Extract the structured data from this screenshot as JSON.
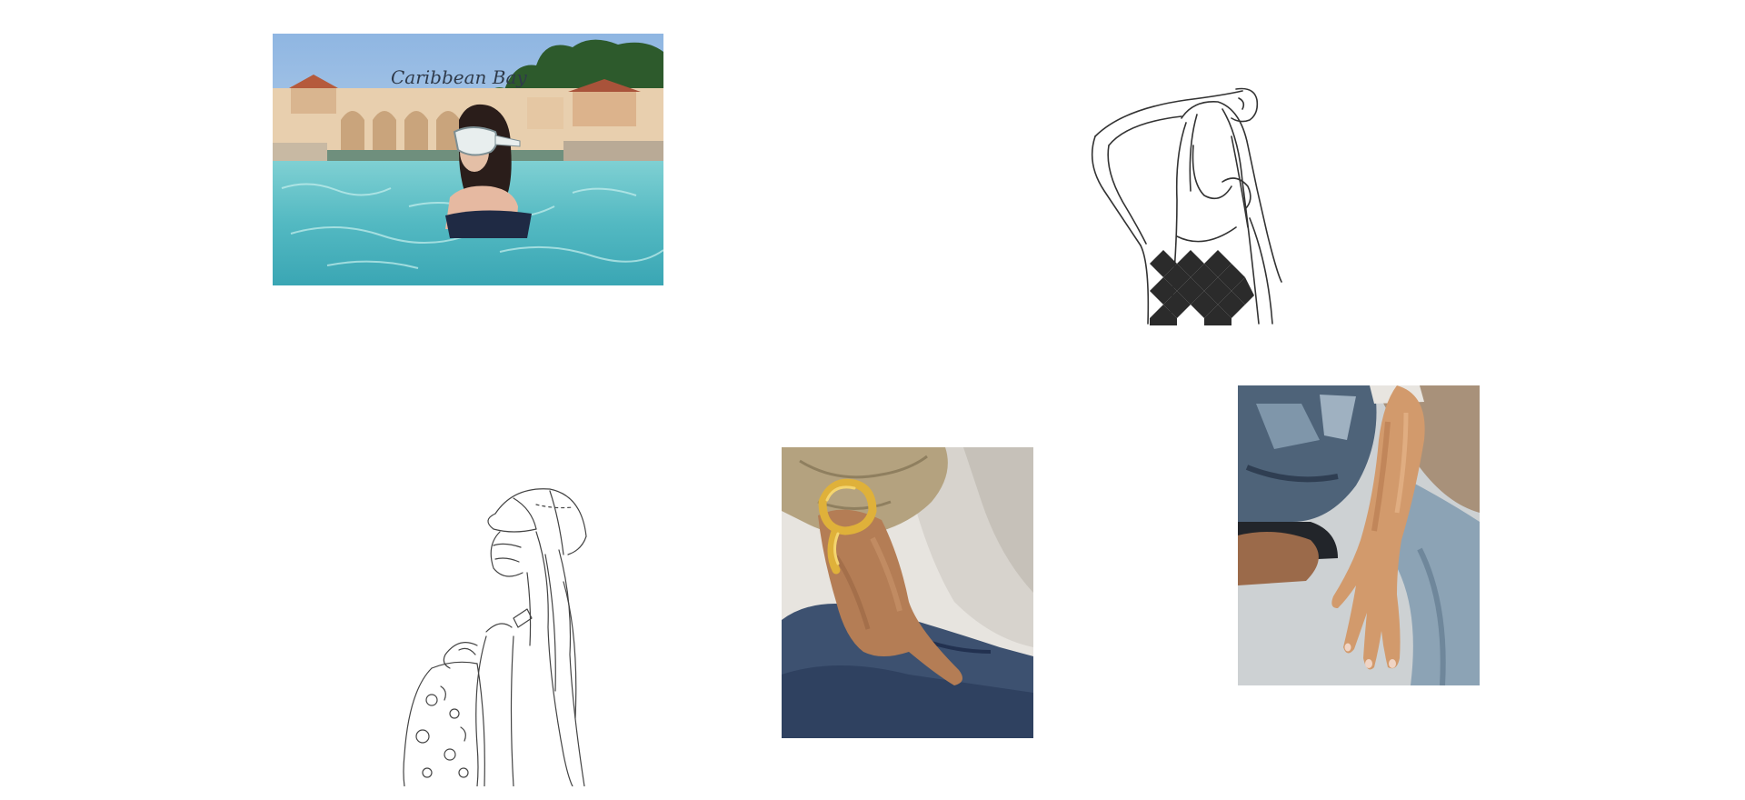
{
  "gallery": {
    "items": [
      {
        "name": "pool-photo",
        "kind": "photo",
        "sign_text": "Caribbean Bay",
        "colors": {
          "sky": "#9fc3e6",
          "water": "#5fc2c4",
          "building": "#e9cfae",
          "trees": "#2e5a2e"
        }
      },
      {
        "name": "lineart-raised-arm",
        "kind": "line-art",
        "colors": {
          "stroke": "#333333",
          "fill": "#2b2b2b"
        }
      },
      {
        "name": "lineart-cap-backpack",
        "kind": "line-art",
        "colors": {
          "stroke": "#444444"
        }
      },
      {
        "name": "vector-bracelet-hand",
        "kind": "vector-illustration",
        "colors": {
          "jacket": "#b5a483",
          "skin": "#b9825a",
          "jeans": "#3f536e",
          "bracelet": "#e0b23a",
          "shirt": "#d9d6d1"
        }
      },
      {
        "name": "vector-hand-jeans",
        "kind": "vector-illustration",
        "colors": {
          "jeans": "#8aa1b3",
          "skin": "#d19a6d",
          "background": "#c9ced1",
          "shirt": "#a58d73"
        }
      }
    ]
  }
}
